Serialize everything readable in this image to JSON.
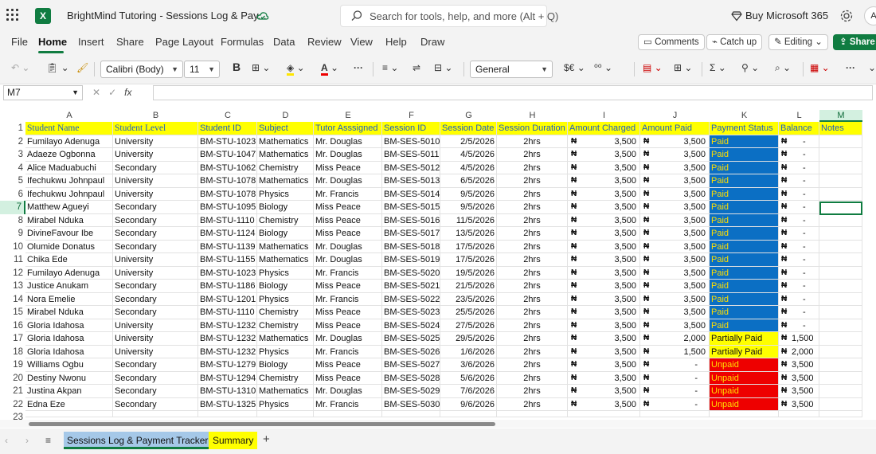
{
  "titlebar": {
    "app_icon": "excel-icon",
    "app_letter": "X",
    "document_title": "BrightMind Tutoring - Sessions Log & Pay...",
    "search_placeholder": "Search for tools, help, and more (Alt + Q)",
    "buy_label": "Buy Microsoft 365",
    "avatar_initial": "A"
  },
  "menu": {
    "items": [
      "File",
      "Home",
      "Insert",
      "Share",
      "Page Layout",
      "Formulas",
      "Data",
      "Review",
      "View",
      "Help",
      "Draw"
    ],
    "active": "Home",
    "comments_label": "Comments",
    "catchup_label": "Catch up",
    "editing_label": "Editing",
    "share_label": "Share"
  },
  "toolbar": {
    "font_name": "Calibri (Body)",
    "font_size": "11",
    "number_format": "General",
    "bold_label": "B",
    "currency_label": "$€",
    "decimals_label": "⁰⁰"
  },
  "formula_bar": {
    "name_box": "M7",
    "fx_label": "fx",
    "formula": ""
  },
  "grid": {
    "columns": [
      "A",
      "B",
      "C",
      "D",
      "E",
      "F",
      "G",
      "H",
      "I",
      "J",
      "K",
      "L",
      "M"
    ],
    "selected_column": "M",
    "selected_row": "7",
    "headers": [
      "Student Name",
      "Student Level",
      "Student ID",
      "Subject",
      "Tutor Asssigned",
      "Session ID",
      "Session Date",
      "Session Duration",
      "Amount Charged",
      "Amount Paid",
      "Payment Status",
      "Balance",
      "Notes"
    ],
    "rows": [
      [
        "Fumilayo Adenuga",
        "University",
        "BM-STU-1023",
        "Mathematics",
        "Mr. Douglas",
        "BM-SES-5010",
        "2/5/2026",
        "2hrs",
        "3,500",
        "3,500",
        "Paid",
        "-"
      ],
      [
        "Adaeze  Ogbonna",
        "University",
        "BM-STU-1047",
        "Mathematics",
        "Mr. Douglas",
        "BM-SES-5011",
        "4/5/2026",
        "2hrs",
        "3,500",
        "3,500",
        "Paid",
        "-"
      ],
      [
        "Alice Maduabuchi",
        "Secondary",
        "BM-STU-1062",
        "Chemistry",
        "Miss Peace",
        "BM-SES-5012",
        "4/5/2026",
        "2hrs",
        "3,500",
        "3,500",
        "Paid",
        "-"
      ],
      [
        "Ifechukwu Johnpaul",
        "University",
        "BM-STU-1078",
        "Mathematics",
        "Mr. Douglas",
        "BM-SES-5013",
        "6/5/2026",
        "2hrs",
        "3,500",
        "3,500",
        "Paid",
        "-"
      ],
      [
        "Ifechukwu Johnpaul",
        "University",
        "BM-STU-1078",
        "Physics",
        "Mr. Francis",
        "BM-SES-5014",
        "9/5/2026",
        "2hrs",
        "3,500",
        "3,500",
        "Paid",
        "-"
      ],
      [
        "Matthew Agueyi",
        "Secondary",
        "BM-STU-1095",
        "Biology",
        "Miss Peace",
        "BM-SES-5015",
        "9/5/2026",
        "2hrs",
        "3,500",
        "3,500",
        "Paid",
        "-"
      ],
      [
        "Mirabel Nduka",
        "Secondary",
        "BM-STU-1110",
        "Chemistry",
        "Miss Peace",
        "BM-SES-5016",
        "11/5/2026",
        "2hrs",
        "3,500",
        "3,500",
        "Paid",
        "-"
      ],
      [
        "DivineFavour Ibe",
        "Secondary",
        "BM-STU-1124",
        "Biology",
        "Miss Peace",
        "BM-SES-5017",
        "13/5/2026",
        "2hrs",
        "3,500",
        "3,500",
        "Paid",
        "-"
      ],
      [
        "Olumide Donatus",
        "Secondary",
        "BM-STU-1139",
        "Mathematics",
        "Mr. Douglas",
        "BM-SES-5018",
        "17/5/2026",
        "2hrs",
        "3,500",
        "3,500",
        "Paid",
        "-"
      ],
      [
        "Chika  Ede",
        "University",
        "BM-STU-1155",
        "Mathematics",
        "Mr. Douglas",
        "BM-SES-5019",
        "17/5/2026",
        "2hrs",
        "3,500",
        "3,500",
        "Paid",
        "-"
      ],
      [
        "Fumilayo Adenuga",
        "University",
        "BM-STU-1023",
        "Physics",
        "Mr. Francis",
        "BM-SES-5020",
        "19/5/2026",
        "2hrs",
        "3,500",
        "3,500",
        "Paid",
        "-"
      ],
      [
        "Justice Anukam",
        "Secondary",
        "BM-STU-1186",
        "Biology",
        "Miss Peace",
        "BM-SES-5021",
        "21/5/2026",
        "2hrs",
        "3,500",
        "3,500",
        "Paid",
        "-"
      ],
      [
        "Nora Emelie",
        "Secondary",
        "BM-STU-1201",
        "Physics",
        "Mr. Francis",
        "BM-SES-5022",
        "23/5/2026",
        "2hrs",
        "3,500",
        "3,500",
        "Paid",
        "-"
      ],
      [
        "Mirabel Nduka",
        "Secondary",
        "BM-STU-1110",
        "Chemistry",
        "Miss Peace",
        "BM-SES-5023",
        "25/5/2026",
        "2hrs",
        "3,500",
        "3,500",
        "Paid",
        "-"
      ],
      [
        "Gloria Idahosa",
        "University",
        "BM-STU-1232",
        "Chemistry",
        "Miss Peace",
        "BM-SES-5024",
        "27/5/2026",
        "2hrs",
        "3,500",
        "3,500",
        "Paid",
        "-"
      ],
      [
        "Gloria Idahosa",
        "University",
        "BM-STU-1232",
        "Mathematics",
        "Mr. Douglas",
        "BM-SES-5025",
        "29/5/2026",
        "2hrs",
        "3,500",
        "2,000",
        "Partially Paid",
        "1,500"
      ],
      [
        "Gloria Idahosa",
        "University",
        "BM-STU-1232",
        "Physics",
        "Mr. Francis",
        "BM-SES-5026",
        "1/6/2026",
        "2hrs",
        "3,500",
        "1,500",
        "Partially Paid",
        "2,000"
      ],
      [
        "Williams Ogbu",
        "Secondary",
        "BM-STU-1279",
        "Biology",
        "Miss Peace",
        "BM-SES-5027",
        "3/6/2026",
        "2hrs",
        "3,500",
        "-",
        "Unpaid",
        "3,500"
      ],
      [
        "Destiny Nwonu",
        "Secondary",
        "BM-STU-1294",
        "Chemistry",
        "Miss Peace",
        "BM-SES-5028",
        "5/6/2026",
        "2hrs",
        "3,500",
        "-",
        "Unpaid",
        "3,500"
      ],
      [
        "Justina Akpan",
        "Secondary",
        "BM-STU-1310",
        "Mathematics",
        "Mr. Douglas",
        "BM-SES-5029",
        "7/6/2026",
        "2hrs",
        "3,500",
        "-",
        "Unpaid",
        "3,500"
      ],
      [
        "Edna Eze",
        "Secondary",
        "BM-STU-1325",
        "Physics",
        "Mr. Francis",
        "BM-SES-5030",
        "9/6/2026",
        "2hrs",
        "3,500",
        "-",
        "Unpaid",
        "3,500"
      ]
    ],
    "currency_symbol": "₦",
    "status_colors": {
      "Paid": "#0b6fc4",
      "Partially Paid": "#ffff00",
      "Unpaid": "#ee0000"
    }
  },
  "sheets": {
    "tabs": [
      "Sessions Log & Payment Tracker",
      "Summary"
    ],
    "active": "Sessions Log & Payment Tracker"
  }
}
